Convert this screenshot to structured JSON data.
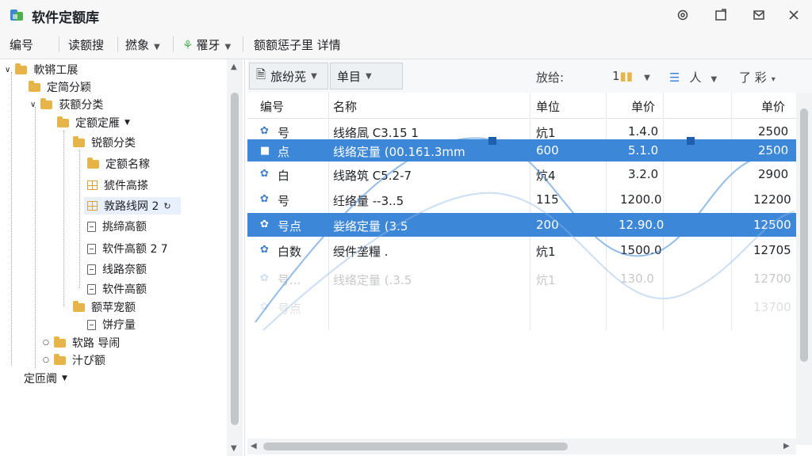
{
  "app": {
    "title": "软件定额库",
    "accent": "#3d87d8"
  },
  "toolbar": {
    "edit": "编号",
    "tool2": "读额搜",
    "tool3": "撚象",
    "tool4": "罹牙",
    "tool5": "额额惩子里 详情"
  },
  "tree": {
    "items": [
      {
        "label": "軟锵工展",
        "icon": "folder-icon"
      },
      {
        "label": "定简分颖",
        "icon": "folder-icon"
      },
      {
        "label": "荻额分类",
        "icon": "folder-icon"
      },
      {
        "label": "定额定雁",
        "icon": "folder-icon"
      },
      {
        "label": "锐额分类",
        "icon": "folder-icon"
      },
      {
        "label": "定额名稼",
        "icon": "folder-icon"
      },
      {
        "label": "猇件高搽",
        "icon": "grid-icon"
      },
      {
        "label": "敦路线网 2",
        "icon": "grid-icon"
      },
      {
        "label": "挑缔高额",
        "icon": "document-icon"
      },
      {
        "label": "软件高额 2 7",
        "icon": "document-icon"
      },
      {
        "label": "线路奈额",
        "icon": "document-icon"
      },
      {
        "label": "软件高额",
        "icon": "document-icon"
      },
      {
        "label": "额苹宠额",
        "icon": "folder-icon"
      },
      {
        "label": "饼疗量",
        "icon": "document-icon"
      },
      {
        "label": "软路 导闹",
        "icon": "folder-icon"
      },
      {
        "label": "汁ぴ额",
        "icon": "folder-icon"
      },
      {
        "label": "定匝阛",
        "icon": "none"
      }
    ]
  },
  "filters": {
    "f1": "旅纷茪",
    "f2": "单目",
    "label1": "放给:",
    "f3": "1",
    "f4": "人",
    "f5": "了 彩"
  },
  "table": {
    "headers": [
      "编号",
      "名称",
      "单位",
      "单价",
      "单价"
    ],
    "rows": [
      {
        "code": "号",
        "name": "线络凮 C3.15 1",
        "unit": "炕1",
        "price": "1.4.0",
        "total": "2500",
        "selected": false
      },
      {
        "code": "点",
        "name": "线络定量 (00.161.3mm",
        "unit": "600",
        "price": "5.1.0",
        "total": "2500",
        "selected": true
      },
      {
        "code": "白",
        "name": "线路筑 C5.2-7",
        "unit": "炕4",
        "price": "3.2.0",
        "total": "2900",
        "selected": false
      },
      {
        "code": "号",
        "name": "纴络量 --3..5",
        "unit": "115",
        "price": "1200.0",
        "total": "12200",
        "selected": false
      },
      {
        "code": "号点",
        "name": "姕络定量 (3.5",
        "unit": "200",
        "price": "12.90.0",
        "total": "12500",
        "selected": true
      },
      {
        "code": "白数",
        "name": "绶件垄糧 .",
        "unit": "炕1",
        "price": "1500.0",
        "total": "12705",
        "selected": false
      },
      {
        "code": "号...",
        "name": "线络定量 (.3.5",
        "unit": "炕1",
        "price": "130.0",
        "total": "12700",
        "selected": false
      },
      {
        "code": "号点",
        "name": "",
        "unit": "",
        "price": "",
        "total": "13700",
        "selected": false
      }
    ]
  }
}
